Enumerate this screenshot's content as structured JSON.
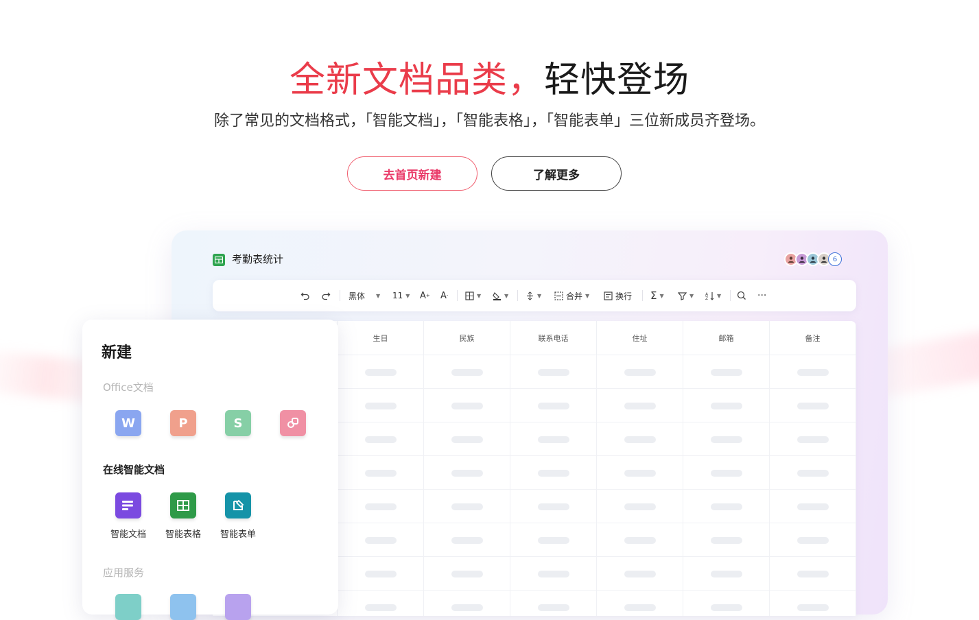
{
  "hero": {
    "title_red": "全新文档品类，",
    "title_black": "轻快登场",
    "subtitle": "除了常见的文档格式，「智能文档」，「智能表格」，「智能表单」三位新成员齐登场。",
    "primary_button": "去首页新建",
    "secondary_button": "了解更多"
  },
  "app": {
    "doc_title": "考勤表统计",
    "collaborator_count": "6",
    "toolbar": {
      "font": "黑体",
      "font_size": "11",
      "merge": "合并",
      "wrap": "换行",
      "more": "···"
    },
    "columns": [
      "生日",
      "民族",
      "联系电话",
      "住址",
      "邮箱",
      "备注"
    ]
  },
  "new_panel": {
    "title": "新建",
    "office_section": "Office文档",
    "office_icons": [
      {
        "letter": "W",
        "color": "#8aa6f0"
      },
      {
        "letter": "P",
        "color": "#f0a08c"
      },
      {
        "letter": "S",
        "color": "#86cfa6"
      },
      {
        "letter": "",
        "color": "#f090a4"
      }
    ],
    "smart_section": "在线智能文档",
    "smart_items": [
      {
        "label": "智能文档",
        "color": "#7b4ae0"
      },
      {
        "label": "智能表格",
        "color": "#2e9a48"
      },
      {
        "label": "智能表单",
        "color": "#1593a8"
      }
    ],
    "service_section": "应用服务"
  }
}
